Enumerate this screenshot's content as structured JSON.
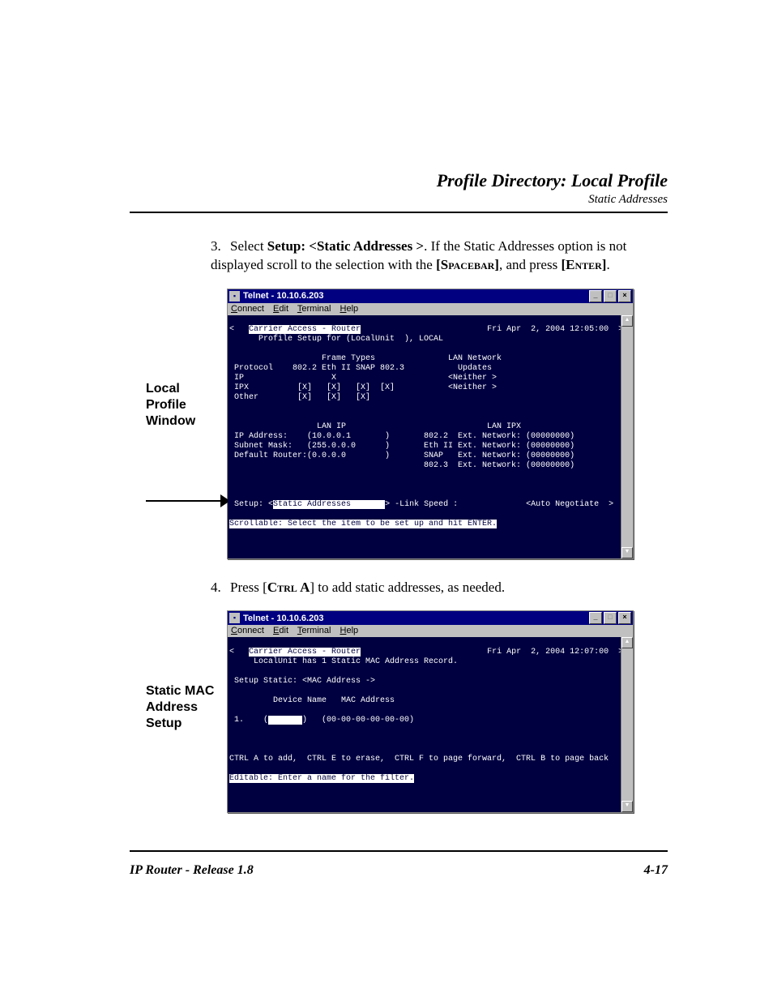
{
  "header": {
    "title": "Profile Directory: Local Profile",
    "subtitle": "Static Addresses"
  },
  "step3": {
    "num": "3.",
    "pre": "Select ",
    "bold": "Setup: <Static Addresses >",
    "post1": ".  If the Static Addresses option is not displayed scroll to the selection with the ",
    "key1": "[Spacebar]",
    "mid": ", and press ",
    "key2": "[Enter]",
    "end": "."
  },
  "labels": {
    "localProfile": "Local\nProfile\nWindow",
    "staticMac": "Static MAC\nAddress\nSetup"
  },
  "step4": {
    "num": "4.",
    "pre": "Press [",
    "key": "Ctrl A",
    "post": "] to add static addresses, as needed."
  },
  "termwin1": {
    "title": "Telnet - 10.10.6.203",
    "menus": [
      "Connect",
      "Edit",
      "Terminal",
      "Help"
    ],
    "datetime": "Fri Apr  2, 2004 12:05:00",
    "topbar_left": "Carrier Access - Router",
    "body_lines": [
      "      Profile Setup for (LocalUnit  ), LOCAL",
      "",
      "                   Frame Types               LAN Network",
      " Protocol    802.2 Eth II SNAP 802.3           Updates",
      " IP                  X                       <Neither >",
      " IPX          [X]   [X]   [X]  [X]           <Neither >",
      " Other        [X]   [X]   [X]",
      "",
      "",
      "                  LAN IP                             LAN IPX",
      " IP Address:    (10.0.0.1       )       802.2  Ext. Network: (00000000)",
      " Subnet Mask:   (255.0.0.0      )       Eth II Ext. Network: (00000000)",
      " Default Router:(0.0.0.0        )       SNAP   Ext. Network: (00000000)",
      "                                        802.3  Ext. Network: (00000000)",
      "",
      "",
      ""
    ],
    "setup_label": "Setup: <",
    "setup_value": "Static Addresses       ",
    "setup_after": "> -Link Speed :              <Auto Negotiate  >",
    "statusbar": "Scrollable: Select the item to be set up and hit ENTER."
  },
  "termwin2": {
    "title": "Telnet - 10.10.6.203",
    "menus": [
      "Connect",
      "Edit",
      "Terminal",
      "Help"
    ],
    "datetime": "Fri Apr  2, 2004 12:07:00",
    "topbar_left": "Carrier Access - Router",
    "body_lines": [
      "     LocalUnit has 1 Static MAC Address Record.",
      "",
      " Setup Static: <MAC Address ->",
      "",
      "         Device Name   MAC Address",
      "",
      " 1.    (       )   (00-00-00-00-00-00)",
      "",
      "",
      "",
      "CTRL A to add,  CTRL E to erase,  CTRL F to page forward,  CTRL B to page back"
    ],
    "input_placeholder": "       ",
    "statusbar": "Editable: Enter a name for the filter."
  },
  "footer": {
    "left": "IP Router - Release 1.8",
    "right": "4-17"
  }
}
